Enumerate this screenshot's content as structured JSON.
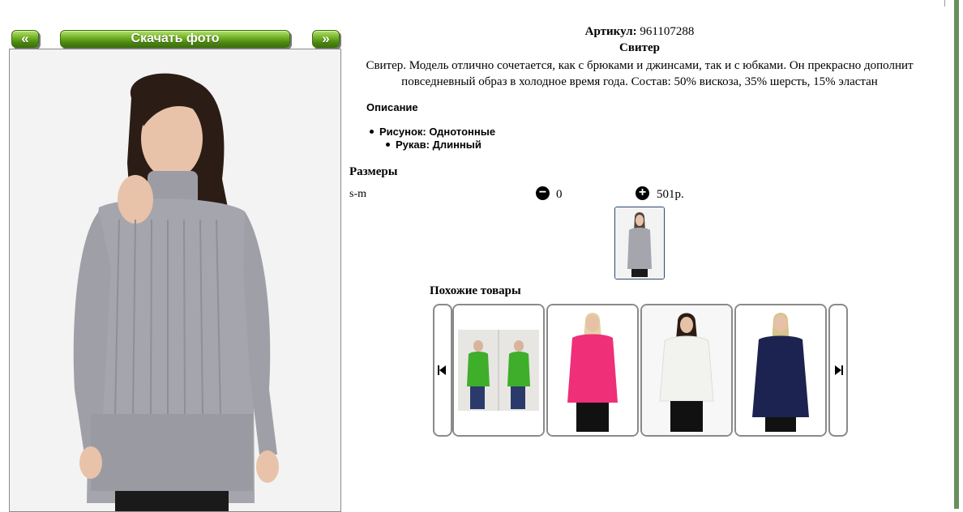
{
  "nav": {
    "prev_label": "«",
    "download_label": "Скачать фото",
    "next_label": "»"
  },
  "product": {
    "article_label": "Артикул:",
    "article_value": "961107288",
    "title": "Свитер",
    "description": "Свитер. Модель отлично сочетается, как с брюками и джинсами, так и с юбками. Он прекрасно дополнит повседневный образ в холодное время года. Состав: 50% вискоза, 35% шерсть, 15% эластан",
    "description_heading": "Описание",
    "attributes": [
      {
        "text": "Рисунок: Однотонные"
      },
      {
        "text": "Рукав: Длинный"
      }
    ]
  },
  "sizes": {
    "heading": "Размеры",
    "rows": [
      {
        "size": "s-m",
        "quantity": "0",
        "price": "501р."
      }
    ]
  },
  "similar": {
    "heading": "Похожие товары",
    "items": [
      {
        "name": "green-sweater",
        "color": "#3fae2a"
      },
      {
        "name": "pink-sweater",
        "color": "#ef2f78"
      },
      {
        "name": "white-sweater",
        "color": "#f2f2ee"
      },
      {
        "name": "navy-sweater",
        "color": "#1c2350"
      }
    ]
  },
  "colors": {
    "main_sweater": "#a5a6ad",
    "button_green": "#5c9a1c",
    "accent_bar": "#6a8f5e"
  },
  "icons": {
    "minus": "minus-circle-icon",
    "plus": "plus-circle-icon",
    "carousel_prev": "skip-previous-icon",
    "carousel_next": "skip-next-icon"
  }
}
